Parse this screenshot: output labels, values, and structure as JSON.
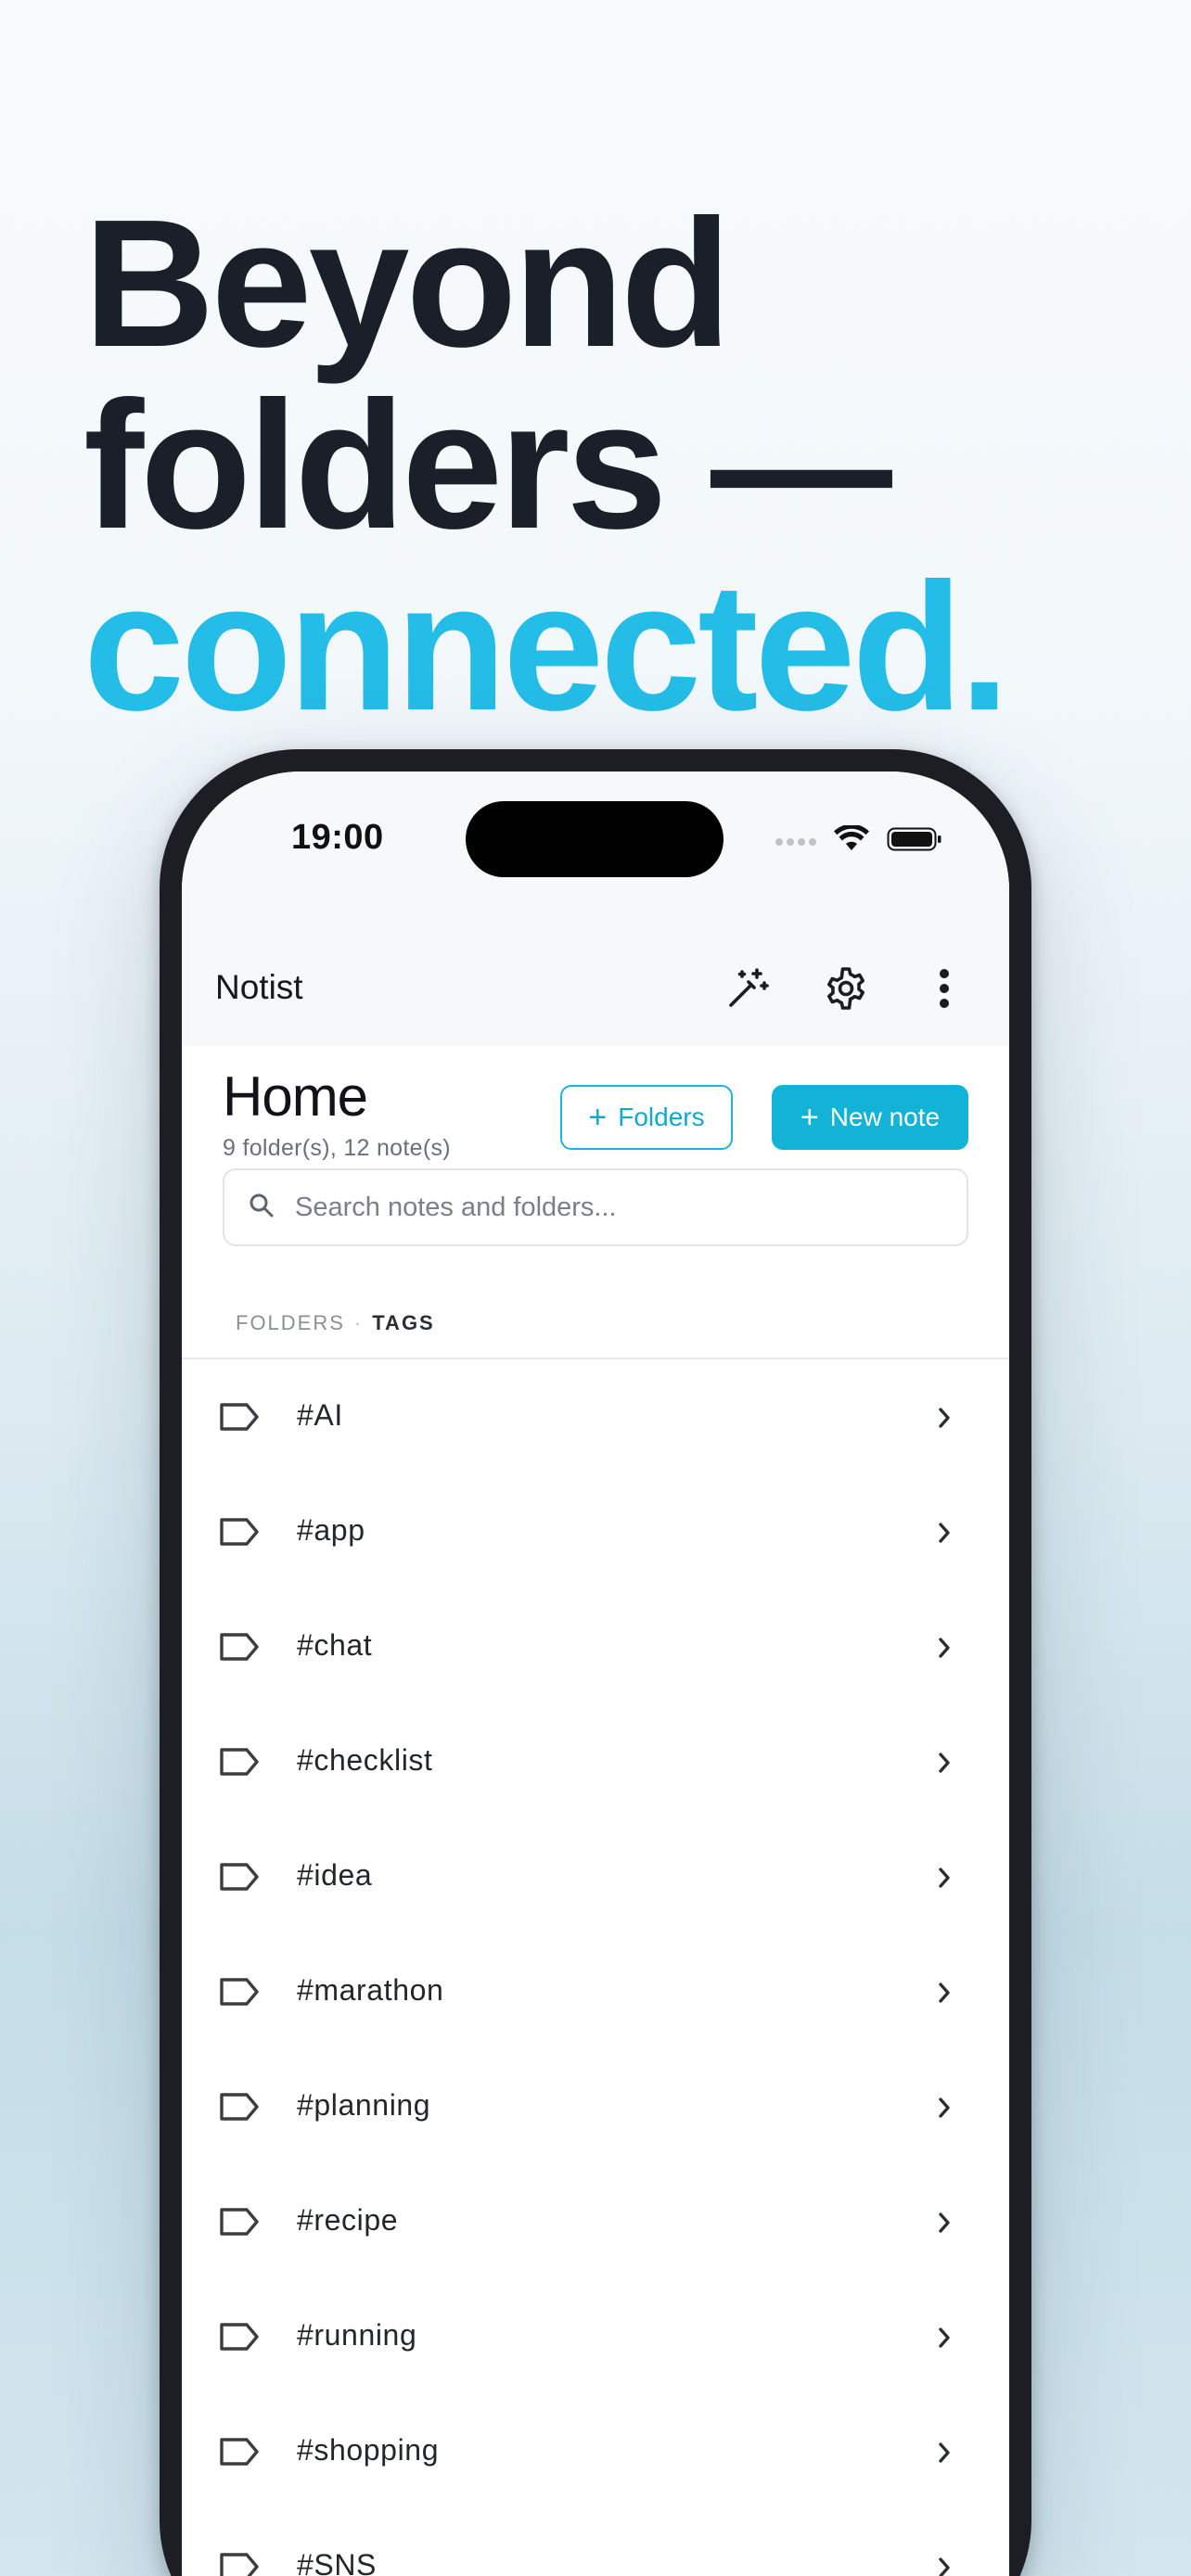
{
  "hero": {
    "line1": "Beyond",
    "line2": "folders —",
    "line3": "connected."
  },
  "status_bar": {
    "time": "19:00"
  },
  "app_bar": {
    "title": "Notist",
    "actions": [
      "magic-wand-icon",
      "gear-icon",
      "more-vertical-icon"
    ]
  },
  "home": {
    "title": "Home",
    "subtitle": "9 folder(s), 12 note(s)",
    "folders_button": "Folders",
    "new_note_button": "New note"
  },
  "search": {
    "placeholder": "Search notes and folders..."
  },
  "segment": {
    "folders": "FOLDERS",
    "separator": "·",
    "tags": "TAGS",
    "selected": "TAGS"
  },
  "tags": [
    {
      "label": "#AI"
    },
    {
      "label": "#app"
    },
    {
      "label": "#chat"
    },
    {
      "label": "#checklist"
    },
    {
      "label": "#idea"
    },
    {
      "label": "#marathon"
    },
    {
      "label": "#planning"
    },
    {
      "label": "#recipe"
    },
    {
      "label": "#running"
    },
    {
      "label": "#shopping"
    },
    {
      "label": "#SNS"
    }
  ],
  "colors": {
    "accent": "#12b3d7",
    "headline_accent": "#24bde8",
    "headline": "#1b1f2a"
  }
}
